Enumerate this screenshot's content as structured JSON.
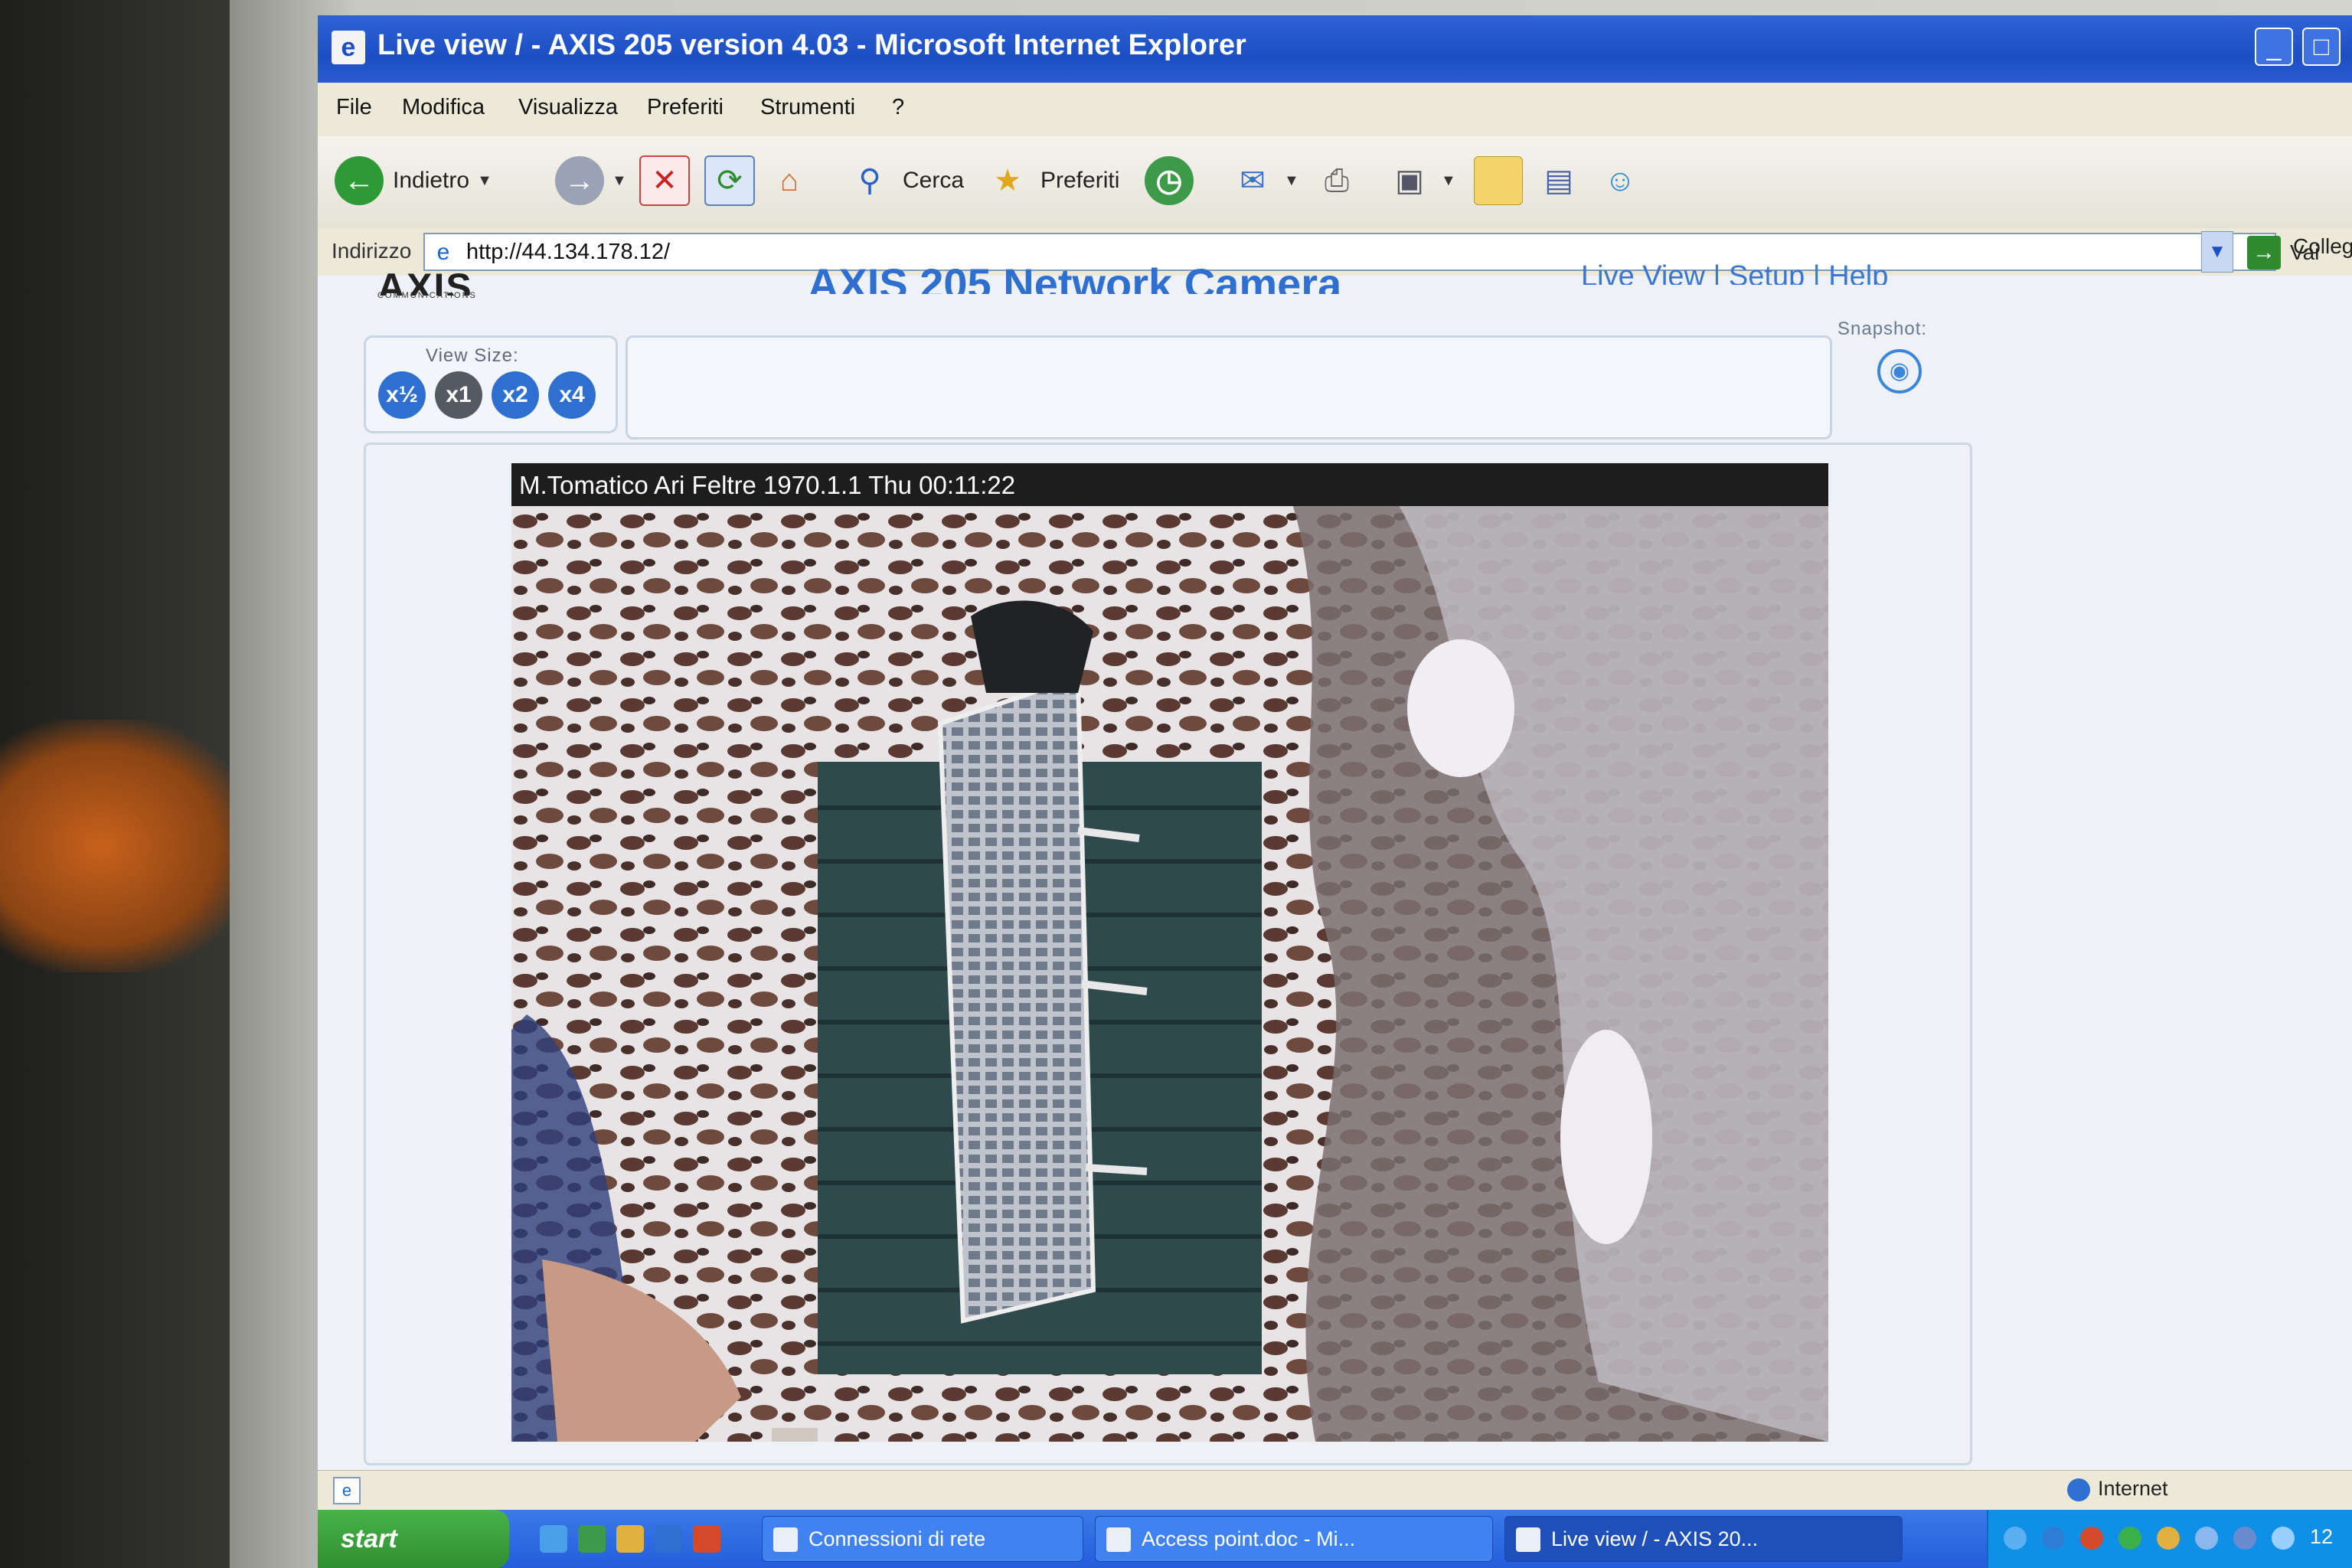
{
  "window": {
    "title": "Live view / - AXIS 205 version 4.03 - Microsoft Internet Explorer",
    "icon": "ie-page-icon"
  },
  "menu": [
    "File",
    "Modifica",
    "Visualizza",
    "Preferiti",
    "Strumenti",
    "?"
  ],
  "toolbar": {
    "back_label": "Indietro",
    "search_label": "Cerca",
    "favorites_label": "Preferiti"
  },
  "address": {
    "label": "Indirizzo",
    "url": "http://44.134.178.12/",
    "go_label": "Vai",
    "links_label": "Collegamenti"
  },
  "page": {
    "logo_text": "AXIS",
    "logo_sub": "COMMUNICATIONS",
    "title": "AXIS 205 Network Camera",
    "top_links": "Live View | Setup | Help",
    "view_size_label": "View Size:",
    "view_sizes": [
      "x½",
      "x1",
      "x2",
      "x4"
    ],
    "snapshot_label": "Snapshot:"
  },
  "video": {
    "overlay_text": "M.Tomatico Ari Feltre  1970.1.1  Thu 00:11:22"
  },
  "status": {
    "zone": "Internet"
  },
  "taskbar": {
    "start_label": "start",
    "items": [
      "Connessioni di rete",
      "Access point.doc - Mi...",
      "Live view / - AXIS 20..."
    ],
    "clock": "12"
  },
  "colors": {
    "title_blue": "#1d4fc4",
    "page_title_blue": "#2f6fd0",
    "view_size_blue": "#2f6fd0",
    "view_size_selected": "#555a62"
  }
}
